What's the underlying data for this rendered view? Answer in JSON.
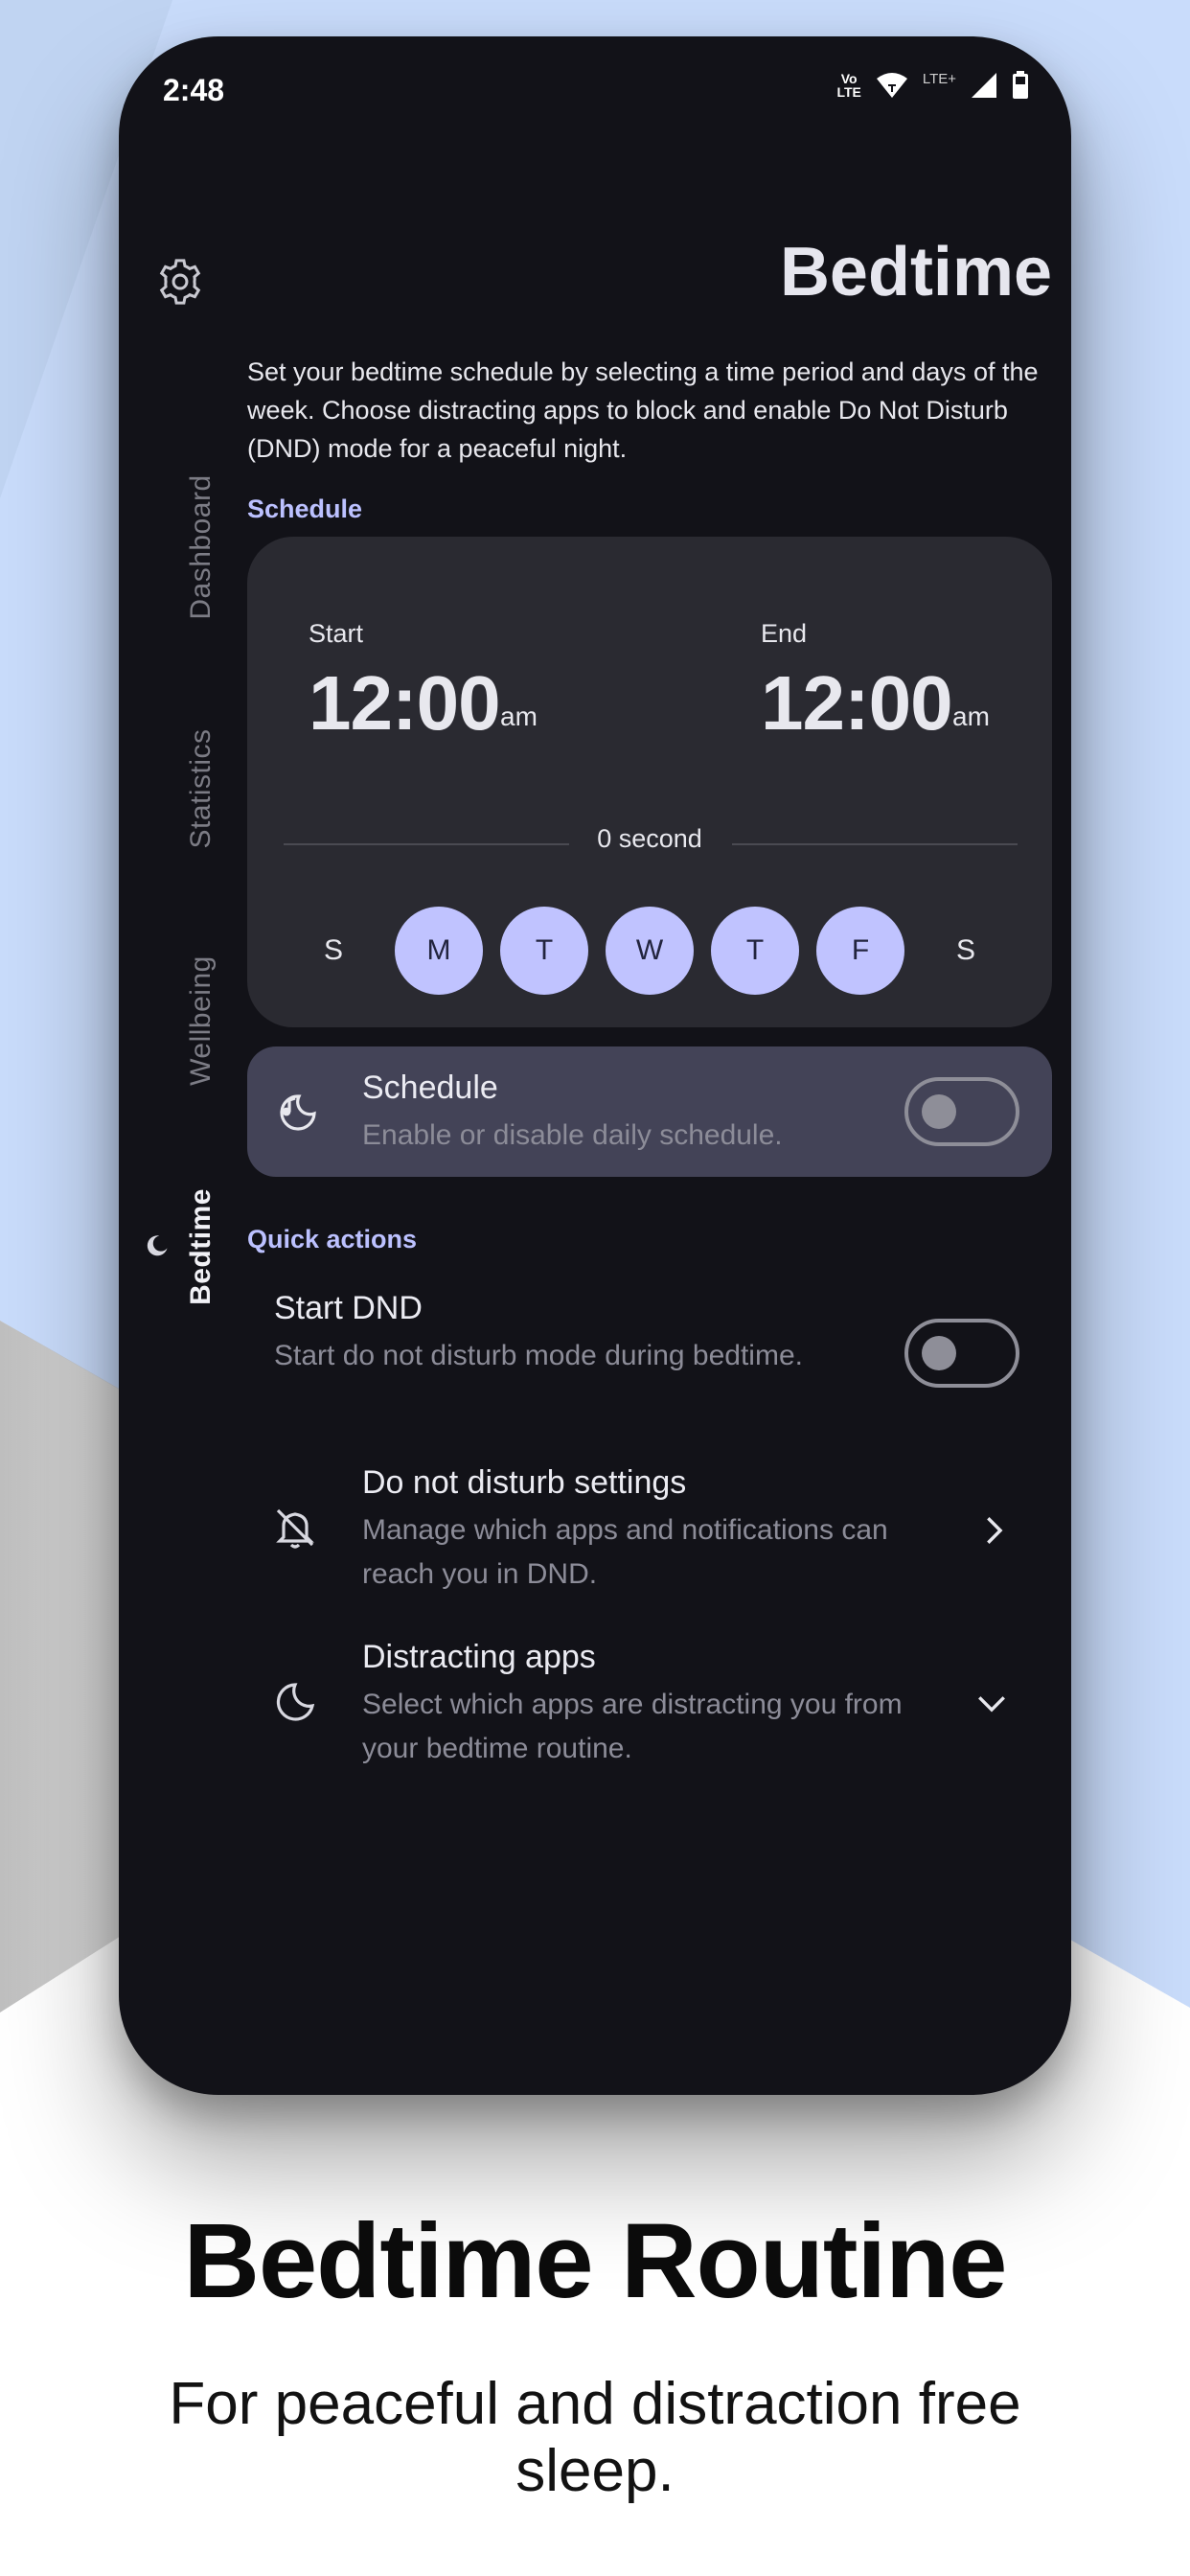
{
  "status_bar": {
    "time": "2:48",
    "network_top": "Vo",
    "network_bottom": "LTE",
    "lte_plus": "LTE+"
  },
  "nav_rail": {
    "items": [
      {
        "label": "Dashboard"
      },
      {
        "label": "Statistics"
      },
      {
        "label": "Wellbeing"
      },
      {
        "label": "Bedtime",
        "active": true
      }
    ]
  },
  "page": {
    "title": "Bedtime",
    "description": "Set your bedtime schedule by selecting a time period and days of the week. Choose distracting apps to block and enable Do Not Disturb (DND) mode for a peaceful night."
  },
  "schedule_section": {
    "label": "Schedule",
    "start_label": "Start",
    "start_time": "12:00",
    "start_ampm": "am",
    "end_label": "End",
    "end_time": "12:00",
    "end_ampm": "am",
    "duration": "0 second",
    "days": [
      {
        "label": "S",
        "selected": false
      },
      {
        "label": "M",
        "selected": true
      },
      {
        "label": "T",
        "selected": true
      },
      {
        "label": "W",
        "selected": true
      },
      {
        "label": "T",
        "selected": true
      },
      {
        "label": "F",
        "selected": true
      },
      {
        "label": "S",
        "selected": false
      }
    ]
  },
  "schedule_toggle": {
    "title": "Schedule",
    "subtitle": "Enable or disable daily schedule.",
    "enabled": false
  },
  "quick_actions": {
    "label": "Quick actions",
    "start_dnd": {
      "title": "Start DND",
      "subtitle": "Start do not disturb mode during bedtime.",
      "enabled": false
    },
    "dnd_settings": {
      "title": "Do not disturb settings",
      "subtitle": "Manage which apps and notifications can reach you in DND."
    },
    "distracting_apps": {
      "title": "Distracting apps",
      "subtitle": "Select which apps are distracting you from your bedtime routine."
    }
  },
  "promo": {
    "title": "Bedtime Routine",
    "subtitle": "For peaceful and distraction free sleep."
  },
  "colors": {
    "phone_bg": "#121218",
    "card_bg": "#2a2a31",
    "toggle_row_bg": "#434357",
    "accent": "#bcc1ff",
    "selected_day": "#c0c3ff",
    "page_bg_blue": "#c9dcfb"
  }
}
